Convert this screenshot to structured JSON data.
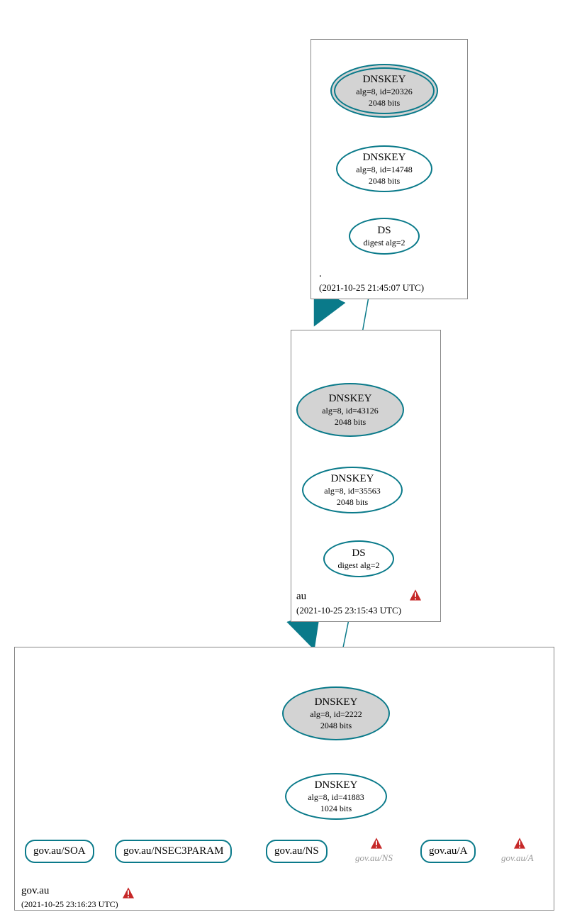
{
  "zones": {
    "root": {
      "label": ".",
      "ts": "(2021-10-25 21:45:07 UTC)"
    },
    "au": {
      "label": "au",
      "ts": "(2021-10-25 23:15:43 UTC)"
    },
    "govau": {
      "label": "gov.au",
      "ts": "(2021-10-25 23:16:23 UTC)"
    }
  },
  "nodes": {
    "rootksk": {
      "title": "DNSKEY",
      "l1": "alg=8, id=20326",
      "l2": "2048 bits"
    },
    "rootzsk": {
      "title": "DNSKEY",
      "l1": "alg=8, id=14748",
      "l2": "2048 bits"
    },
    "rootds": {
      "title": "DS",
      "l1": "digest alg=2"
    },
    "auksk": {
      "title": "DNSKEY",
      "l1": "alg=8, id=43126",
      "l2": "2048 bits"
    },
    "auzsk": {
      "title": "DNSKEY",
      "l1": "alg=8, id=35563",
      "l2": "2048 bits"
    },
    "auds": {
      "title": "DS",
      "l1": "digest alg=2"
    },
    "govksk": {
      "title": "DNSKEY",
      "l1": "alg=8, id=2222",
      "l2": "2048 bits"
    },
    "govzsk": {
      "title": "DNSKEY",
      "l1": "alg=8, id=41883",
      "l2": "1024 bits"
    },
    "soa": {
      "title": "gov.au/SOA"
    },
    "n3p": {
      "title": "gov.au/NSEC3PARAM"
    },
    "ns": {
      "title": "gov.au/NS"
    },
    "a": {
      "title": "gov.au/A"
    }
  },
  "ghost": {
    "ns": "gov.au/NS",
    "a": "gov.au/A"
  },
  "colors": {
    "stroke": "#0a7a8a",
    "warn_fill": "#c62828",
    "warn_stroke": "#ffffff"
  }
}
